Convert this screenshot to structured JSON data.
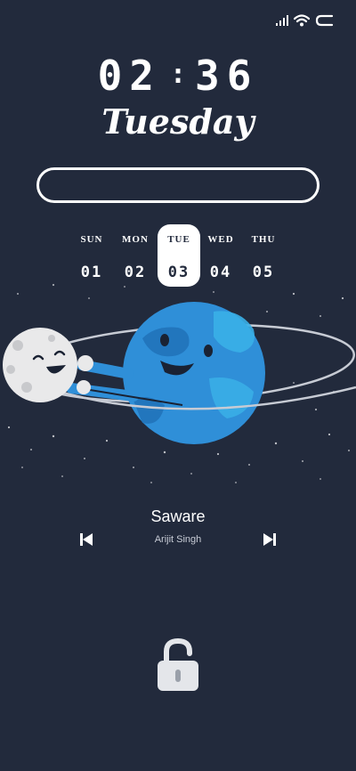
{
  "status_bar": {
    "icons": [
      "signal-icon",
      "wifi-icon",
      "battery-icon"
    ]
  },
  "clock": {
    "hours": "02",
    "separator": ":",
    "minutes": "36",
    "weekday": "Tuesday"
  },
  "search": {
    "value": "",
    "placeholder": ""
  },
  "calendar": {
    "days": [
      {
        "name": "SUN",
        "date": "01",
        "active": false
      },
      {
        "name": "MON",
        "date": "02",
        "active": false
      },
      {
        "name": "TUE",
        "date": "03",
        "active": true
      },
      {
        "name": "WED",
        "date": "04",
        "active": false
      },
      {
        "name": "THU",
        "date": "05",
        "active": false
      }
    ]
  },
  "illustration": {
    "subject": "earth-and-moon-illustration"
  },
  "music": {
    "title": "Saware",
    "artist": "Arijit Singh"
  },
  "colors": {
    "background": "#222a3c",
    "earth": "#2f8fd8",
    "moon": "#e9e9ea",
    "foreground": "#ffffff"
  }
}
